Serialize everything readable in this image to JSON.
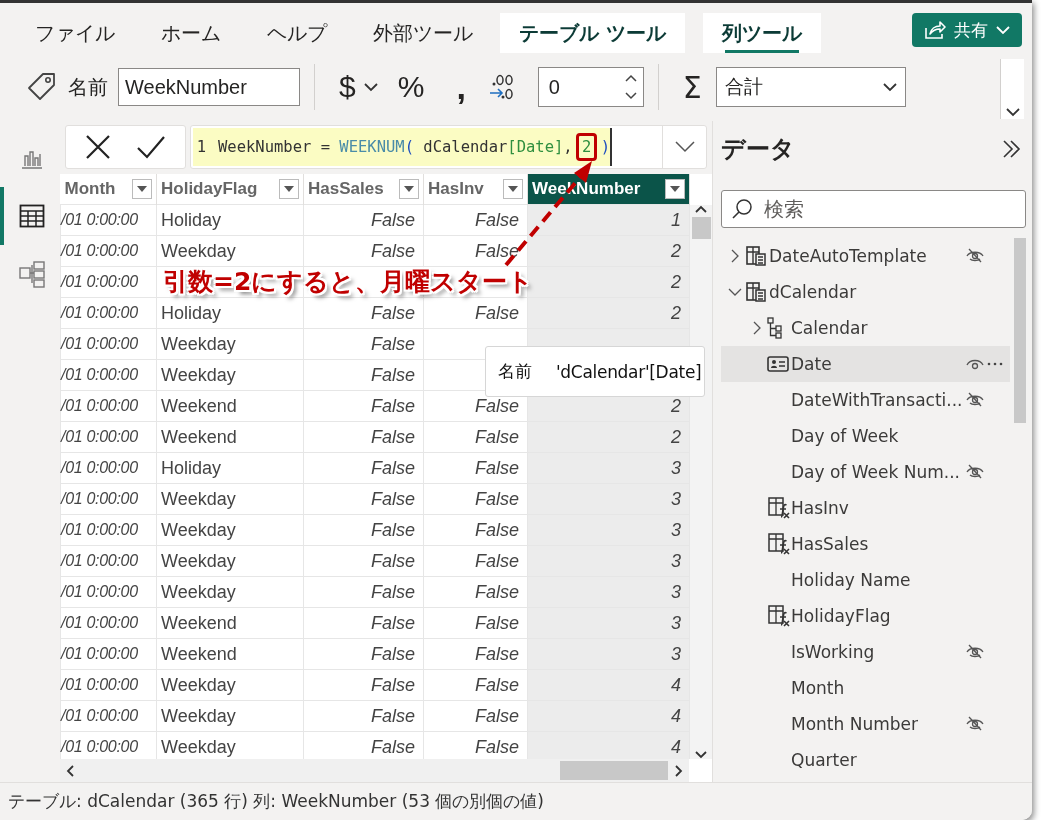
{
  "ribbon": {
    "tabs": [
      {
        "label": "ファイル",
        "contextual": false,
        "selected": false
      },
      {
        "label": "ホーム",
        "contextual": false,
        "selected": false
      },
      {
        "label": "ヘルプ",
        "contextual": false,
        "selected": false
      },
      {
        "label": "外部ツール",
        "contextual": false,
        "selected": false
      },
      {
        "label": "テーブル ツール",
        "contextual": true,
        "selected": false
      },
      {
        "label": "列ツール",
        "contextual": true,
        "selected": true
      }
    ],
    "share_button": "共有",
    "name_label": "名前",
    "name_value": "WeekNumber",
    "format_buttons": [
      {
        "label": "$",
        "kind": "dropdown"
      },
      {
        "label": "%",
        "kind": "plain"
      },
      {
        "label": ",",
        "kind": "bold"
      }
    ],
    "decimal_places": "0",
    "sum_label": "Σ",
    "summarization": "合計"
  },
  "nav": [
    {
      "kind": "report",
      "selected": false
    },
    {
      "kind": "table",
      "selected": true
    },
    {
      "kind": "model",
      "selected": false
    }
  ],
  "formula": {
    "line_number": "1",
    "tokens": [
      {
        "text": "WeekNumber = ",
        "kind": "plain",
        "boxed": false
      },
      {
        "text": "WEEKNUM",
        "kind": "function",
        "boxed": false
      },
      {
        "text": "( ",
        "kind": "paren",
        "boxed": false
      },
      {
        "text": "dCalendar",
        "kind": "plain",
        "boxed": false
      },
      {
        "text": "[Date]",
        "kind": "column",
        "boxed": false
      },
      {
        "text": ", ",
        "kind": "plain",
        "boxed": false
      },
      {
        "text": "2",
        "kind": "number",
        "boxed": true
      },
      {
        "text": " )",
        "kind": "paren",
        "boxed": false
      }
    ]
  },
  "table": {
    "columns": [
      {
        "label": "Month",
        "kind": "datetime",
        "selected": false
      },
      {
        "label": "HolidayFlag",
        "kind": "text",
        "selected": false
      },
      {
        "label": "HasSales",
        "kind": "boolean",
        "selected": false
      },
      {
        "label": "HasInv",
        "kind": "boolean",
        "selected": false
      },
      {
        "label": "WeekNumber",
        "kind": "number",
        "selected": true
      }
    ],
    "rows": [
      [
        "/01 0:00:00",
        "Holiday",
        "False",
        "False",
        "1"
      ],
      [
        "/01 0:00:00",
        "Weekday",
        "False",
        "False",
        "2"
      ],
      [
        "/01 0:00:00",
        null,
        null,
        null,
        "2"
      ],
      [
        "/01 0:00:00",
        "Holiday",
        "False",
        "False",
        "2"
      ],
      [
        "/01 0:00:00",
        "Weekday",
        "False",
        null,
        null
      ],
      [
        "/01 0:00:00",
        "Weekday",
        "False",
        null,
        null
      ],
      [
        "/01 0:00:00",
        "Weekend",
        "False",
        "False",
        "2"
      ],
      [
        "/01 0:00:00",
        "Weekend",
        "False",
        "False",
        "2"
      ],
      [
        "/01 0:00:00",
        "Holiday",
        "False",
        "False",
        "3"
      ],
      [
        "/01 0:00:00",
        "Weekday",
        "False",
        "False",
        "3"
      ],
      [
        "/01 0:00:00",
        "Weekday",
        "False",
        "False",
        "3"
      ],
      [
        "/01 0:00:00",
        "Weekday",
        "False",
        "False",
        "3"
      ],
      [
        "/01 0:00:00",
        "Weekday",
        "False",
        "False",
        "3"
      ],
      [
        "/01 0:00:00",
        "Weekend",
        "False",
        "False",
        "3"
      ],
      [
        "/01 0:00:00",
        "Weekend",
        "False",
        "False",
        "3"
      ],
      [
        "/01 0:00:00",
        "Weekday",
        "False",
        "False",
        "4"
      ],
      [
        "/01 0:00:00",
        "Weekday",
        "False",
        "False",
        "4"
      ],
      [
        "/01 0:00:00",
        "Weekday",
        "False",
        "False",
        "4"
      ]
    ]
  },
  "annotation": "引数=2にすると、月曜スタート",
  "tooltip": {
    "label": "名前",
    "value": "'dCalendar'[Date]"
  },
  "data_pane": {
    "title": "データ",
    "search_placeholder": "検索",
    "items": [
      {
        "label": "DateAutoTemplate",
        "kind": "table",
        "expanded": false,
        "hidden": true,
        "selected": false
      },
      {
        "label": "dCalendar",
        "kind": "table",
        "expanded": true,
        "hidden": false,
        "selected": false,
        "children": [
          {
            "label": "Calendar",
            "kind": "hierarchy",
            "expanded": false,
            "hidden": false,
            "selected": false
          },
          {
            "label": "Date",
            "kind": "date",
            "hidden": false,
            "selected": true
          },
          {
            "label": "DateWithTransacti...",
            "kind": "column",
            "hidden": true,
            "selected": false
          },
          {
            "label": "Day of Week",
            "kind": "column",
            "hidden": false,
            "selected": false
          },
          {
            "label": "Day of Week Num...",
            "kind": "column",
            "hidden": true,
            "selected": false
          },
          {
            "label": "HasInv",
            "kind": "calculated",
            "hidden": false,
            "selected": false
          },
          {
            "label": "HasSales",
            "kind": "calculated",
            "hidden": false,
            "selected": false
          },
          {
            "label": "Holiday Name",
            "kind": "column",
            "hidden": false,
            "selected": false
          },
          {
            "label": "HolidayFlag",
            "kind": "calculated",
            "hidden": false,
            "selected": false
          },
          {
            "label": "IsWorking",
            "kind": "column",
            "hidden": true,
            "selected": false
          },
          {
            "label": "Month",
            "kind": "column",
            "hidden": false,
            "selected": false
          },
          {
            "label": "Month Number",
            "kind": "column",
            "hidden": true,
            "selected": false
          },
          {
            "label": "Quarter",
            "kind": "column",
            "hidden": false,
            "selected": false
          }
        ]
      }
    ]
  },
  "status_bar": "テーブル: dCalendar (365 行) 列: WeekNumber (53 個の別個の値)"
}
